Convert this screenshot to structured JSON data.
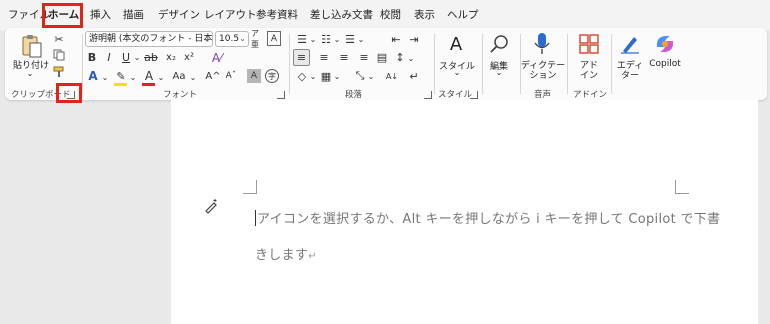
{
  "tabs": [
    "ファイル",
    "ホーム",
    "挿入",
    "描画",
    "デザイン",
    "レイアウト",
    "参考資料",
    "差し込み文書",
    "校閲",
    "表示",
    "ヘルプ"
  ],
  "active_tab_index": 1,
  "ribbon": {
    "clipboard": {
      "paste_label": "貼り付け",
      "group_label": "クリップボード"
    },
    "font": {
      "font_name": "游明朝 (本文のフォント - 日本語)",
      "font_size": "10.5",
      "bold": "B",
      "italic": "I",
      "underline": "U",
      "strike": "ab",
      "subscript": "x₂",
      "superscript": "x²",
      "grow": "A^",
      "shrink": "Aˇ",
      "case": "Aa",
      "group_label": "フォント"
    },
    "paragraph": {
      "group_label": "段落"
    },
    "styles": {
      "button_label": "スタイル",
      "group_label": "スタイル"
    },
    "editing": {
      "button_label": "編集"
    },
    "voice": {
      "button_label": "ディクテーション",
      "button_label_line1": "ディクテー",
      "button_label_line2": "ション",
      "group_label": "音声"
    },
    "addins": {
      "button_label_line1": "アド",
      "button_label_line2": "イン",
      "group_label": "アドイン"
    },
    "editor": {
      "button_label_line1": "エディ",
      "button_label_line2": "ター"
    },
    "copilot": {
      "button_label": "Copilot"
    }
  },
  "document": {
    "line1": "アイコンを選択するか、Alt キーを押しながら i キーを押して Copilot で下書",
    "line2": "きします"
  },
  "colors": {
    "highlight_box": "#e2231a",
    "font_color_bar": "#e2231a",
    "highlighter_bar": "#f5e400",
    "active_tab_underline": "#1f5fbf"
  },
  "icons": [
    "paste-icon",
    "cut-icon",
    "copy-icon",
    "format-painter-icon",
    "clear-format-icon",
    "text-effects-icon",
    "highlighter-icon",
    "font-color-icon",
    "char-shading-icon",
    "enclose-char-icon",
    "bullets-icon",
    "numbering-icon",
    "multilevel-icon",
    "decrease-indent-icon",
    "increase-indent-icon",
    "align-left-icon",
    "align-center-icon",
    "align-right-icon",
    "justify-icon",
    "distributed-icon",
    "line-spacing-icon",
    "shading-icon",
    "borders-icon",
    "sort-icon",
    "show-marks-icon",
    "styles-icon",
    "search-icon",
    "mic-icon",
    "addins-icon",
    "editor-icon",
    "copilot-icon",
    "draft-copilot-icon"
  ]
}
